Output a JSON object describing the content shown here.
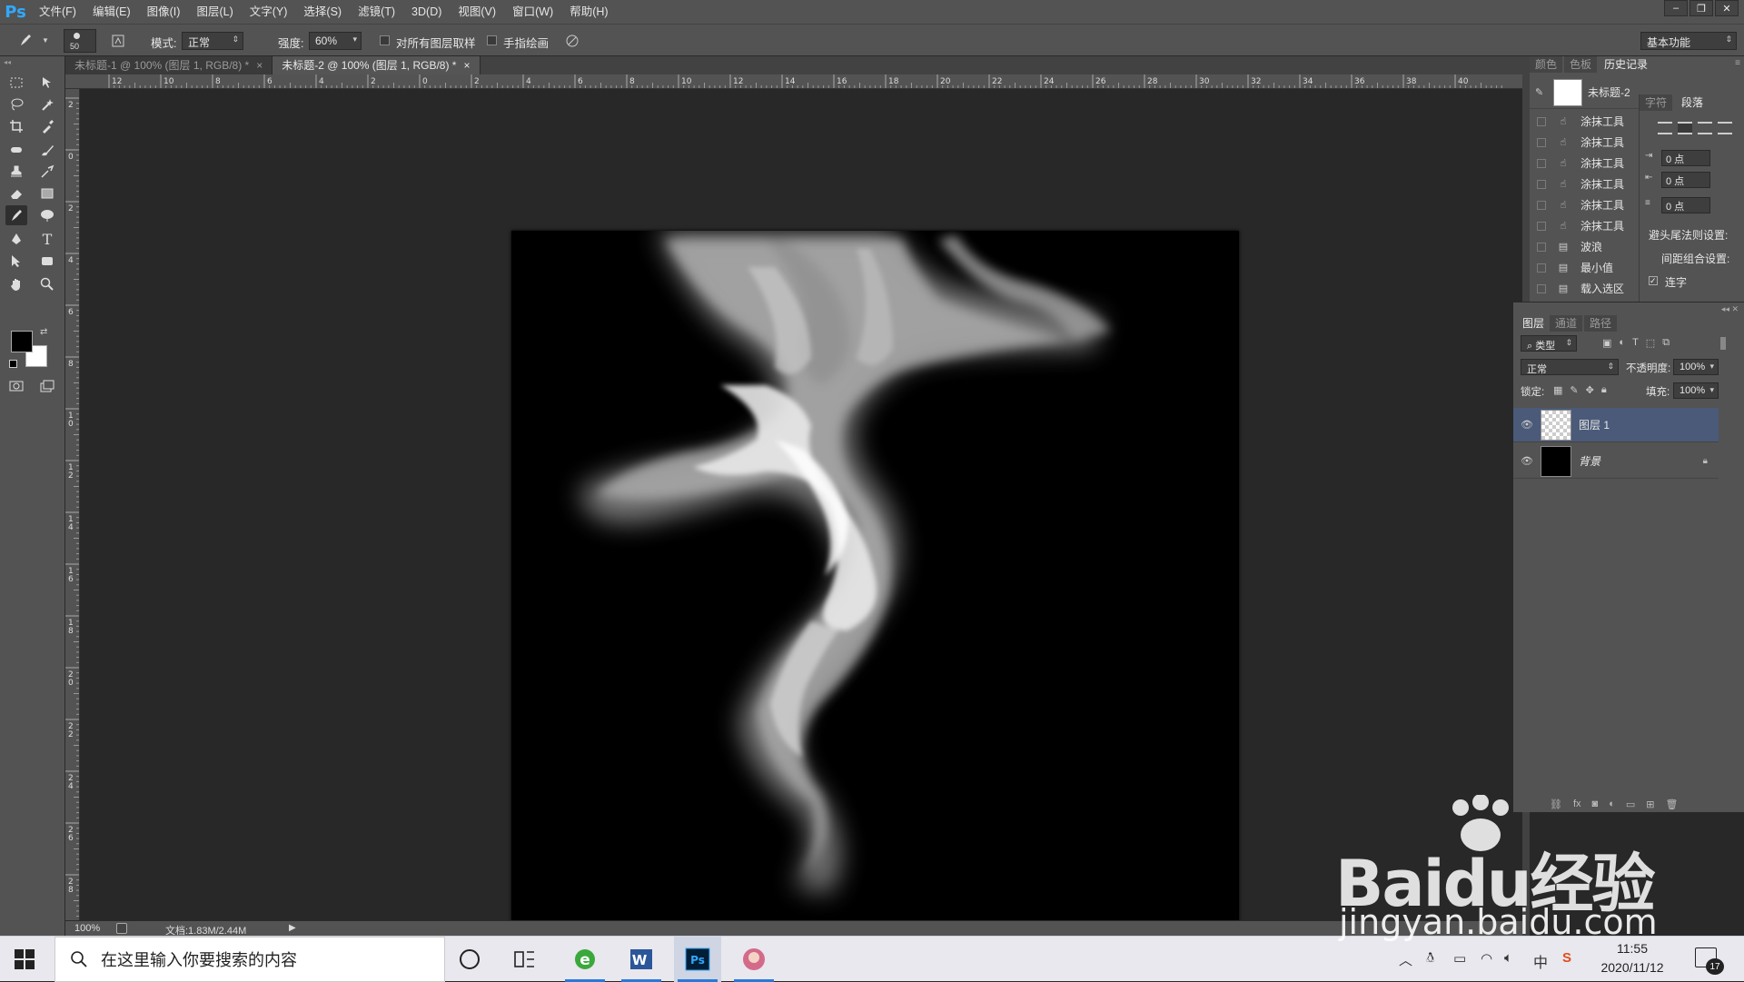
{
  "app": {
    "logo": "Ps"
  },
  "menu": {
    "items": [
      "文件(F)",
      "编辑(E)",
      "图像(I)",
      "图层(L)",
      "文字(Y)",
      "选择(S)",
      "滤镜(T)",
      "3D(D)",
      "视图(V)",
      "窗口(W)",
      "帮助(H)"
    ]
  },
  "window_controls": {
    "minimize": "–",
    "restore": "❐",
    "close": "✕"
  },
  "options": {
    "brush_size": "50",
    "mode_label": "模式:",
    "mode_value": "正常",
    "strength_label": "强度:",
    "strength_value": "60%",
    "sample_all_layers": "对所有图层取样",
    "finger_painting": "手指绘画",
    "workspace": "基本功能"
  },
  "tabs": [
    {
      "label": "未标题-1 @ 100% (图层 1, RGB/8) *",
      "close": "×",
      "active": false
    },
    {
      "label": "未标题-2 @ 100% (图层 1, RGB/8) *",
      "close": "×",
      "active": true
    }
  ],
  "ruler": {
    "top_ticks": [
      "12",
      "10",
      "8",
      "6",
      "4",
      "2",
      "0",
      "2",
      "4",
      "6",
      "8",
      "10",
      "12",
      "14",
      "16",
      "18",
      "20",
      "22",
      "24",
      "26",
      "28",
      "30",
      "32",
      "34",
      "36",
      "38",
      "40"
    ],
    "left_ticks": [
      "2",
      "0",
      "2",
      "4",
      "6",
      "8",
      "10",
      "12",
      "14",
      "16",
      "18",
      "20",
      "22",
      "24",
      "26",
      "28"
    ]
  },
  "status": {
    "zoom": "100%",
    "doc": "文档:1.83M/2.44M"
  },
  "panels_top": {
    "tabs": [
      "颜色",
      "色板",
      "历史记录"
    ],
    "snapshot_label": "未标题-2",
    "history": [
      {
        "icon": "smudge-icon",
        "label": "涂抹工具"
      },
      {
        "icon": "smudge-icon",
        "label": "涂抹工具"
      },
      {
        "icon": "smudge-icon",
        "label": "涂抹工具"
      },
      {
        "icon": "smudge-icon",
        "label": "涂抹工具"
      },
      {
        "icon": "smudge-icon",
        "label": "涂抹工具"
      },
      {
        "icon": "smudge-icon",
        "label": "涂抹工具"
      },
      {
        "icon": "document-icon",
        "label": "波浪"
      },
      {
        "icon": "document-icon",
        "label": "最小值"
      },
      {
        "icon": "document-icon",
        "label": "载入选区"
      }
    ]
  },
  "paragraph": {
    "tabs": [
      "字符",
      "段落"
    ],
    "indent_left": "0 点",
    "indent_first": "0 点",
    "space_before": "0 点",
    "hyphenation_label": "避头尾法则设置:",
    "spacing_label": "间距组合设置:",
    "hyphenate_label": "连字"
  },
  "layers": {
    "tabs": [
      "图层",
      "通道",
      "路径"
    ],
    "kind_label": "类型",
    "blend_mode": "正常",
    "opacity_label": "不透明度:",
    "opacity_value": "100%",
    "lock_label": "锁定:",
    "fill_label": "填充:",
    "fill_value": "100%",
    "items": [
      {
        "name": "图层 1",
        "selected": true
      },
      {
        "name": "背景",
        "locked": true
      }
    ]
  },
  "taskbar": {
    "search_placeholder": "在这里输入你要搜索的内容",
    "time": "11:55",
    "date": "2020/11/12",
    "ime": "中",
    "notification_count": "17"
  },
  "watermark": {
    "brand_top": "Baidu经验",
    "brand_bottom": "jingyan.baidu.com"
  },
  "colors": {
    "accent": "#31a8ff",
    "selected_layer": "#4a5a78",
    "canvas_bg": "#000000"
  }
}
